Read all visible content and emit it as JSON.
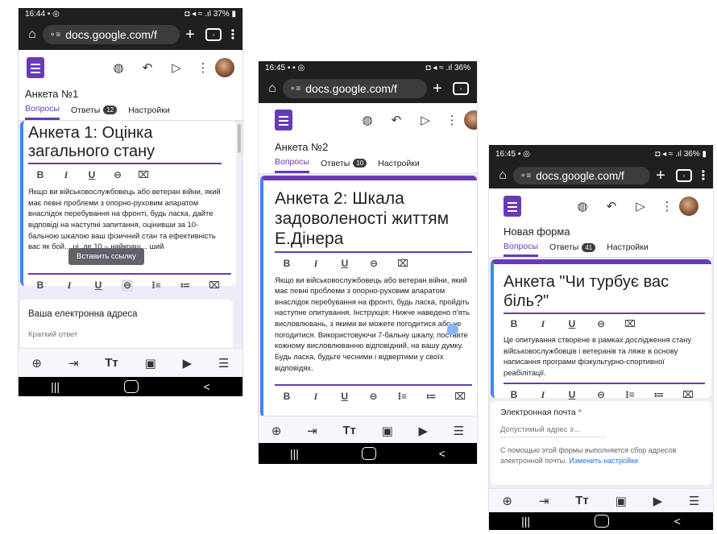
{
  "phone1": {
    "status": {
      "time": "16:44",
      "icons_left": "▪ ◎",
      "icons_right": "◘ ◂ ≈ .ıl 37% ▮"
    },
    "url": "docs.google.com/f",
    "form_title": "Анкета №1",
    "tabs": [
      {
        "label": "Вопросы"
      },
      {
        "label": "Ответы",
        "badge": "12"
      },
      {
        "label": "Настройки"
      }
    ],
    "heading": "Анкета 1:  Оцінка загального стану",
    "description": "Якщо ви військовослужбовець або ветеран війни, який має певні проблеми з опорно-руховим апаратом внаслідок перебування на фронті, будь ласка,  дайте відповіді на наступні запитання, оцінивши за 10-бальною шкалою ваш фізичний стан та ефективність вас як бой... ці, де 10 – найкращ... ший",
    "tooltip": "Вставить ссылку",
    "question_title": "Ваша електронна адреса",
    "question_placeholder": "Краткий ответ"
  },
  "phone2": {
    "status": {
      "time": "16:45",
      "icons_left": "▪ ▪ ◎",
      "icons_right": "◘ ◂ ≈ .ıl 36%"
    },
    "url": "docs.google.com/f",
    "form_title": "Анкета №2",
    "tabs": [
      {
        "label": "Вопросы"
      },
      {
        "label": "Ответы",
        "badge": "10"
      },
      {
        "label": "Настройки"
      }
    ],
    "heading": "Анкета 2: Шкала задоволеності життям Е.Дінера",
    "description": "Якщо ви військовослужбовець або ветеран війни, який має певні проблеми з опорно-руховим апаратом внаслідок перебування на фронті, будь ласка,  пройдіть наступне опитування. Інструкція: Нижче наведено п'ять висловлювань, з якими ви можете погодитися або не погодитися. Використовуючи 7-бальну шкалу, поставте кожному висловлюванню відповідний, на вашу думку. Будь ласка, будьте чесними і відвертими у своїх відповідях."
  },
  "phone3": {
    "status": {
      "time": "16:45",
      "icons_left": "▪ ◎",
      "icons_right": "◘ ◂ ≈ .ıl 36% ▮"
    },
    "url": "docs.google.com/f",
    "form_title": "Новая форма",
    "tabs": [
      {
        "label": "Вопросы"
      },
      {
        "label": "Ответы",
        "badge": "41"
      },
      {
        "label": "Настройки"
      }
    ],
    "heading": "Анкета \"Чи турбує вас біль?\"",
    "description": "Це опитування створене в рамках дослідження стану військовослужбовців і ветеранів та ляже в основу написання програми  фізкультурно-спортивної реабілітації.",
    "email_label": "Электронная почта",
    "email_required": "*",
    "email_placeholder": "Допустимый адрес э...",
    "email_note": "С помощью этой формы выполняется сбор адресов электронной почты.",
    "email_link": "Изменить настройки"
  },
  "toolbar_labels": {
    "bold": "B",
    "italic": "I",
    "underline": "U",
    "link": "⊖",
    "clear": "⌧",
    "ol": "⁝≡",
    "ul": "≔"
  },
  "bottom_tools": {
    "add": "⊕",
    "import": "⇥",
    "text": "Tт",
    "image": "▣",
    "video": "▶",
    "section": "☰"
  },
  "nav": {
    "recent": "|||",
    "back": "<"
  }
}
